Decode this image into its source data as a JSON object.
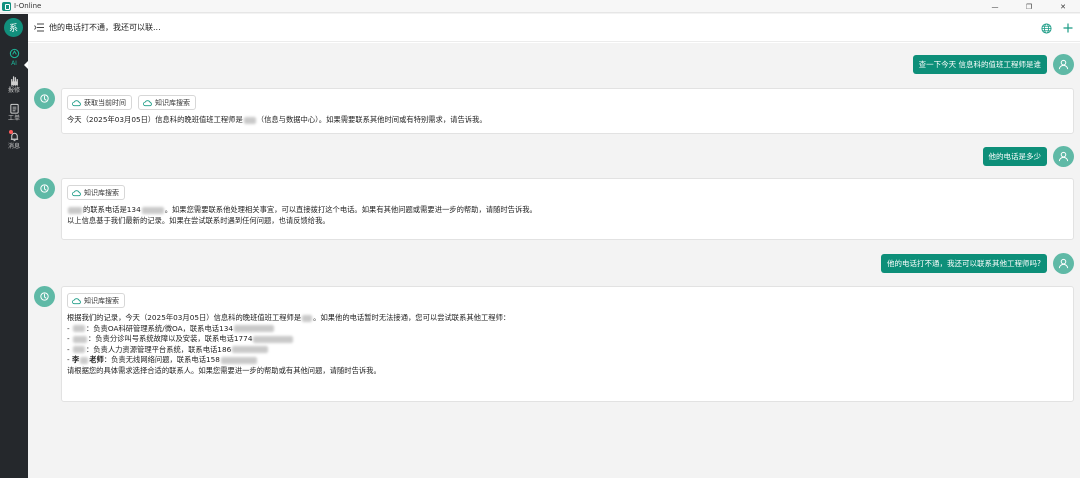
{
  "app": {
    "title": "I-Online"
  },
  "window": {
    "minimize": "—",
    "restore": "❐",
    "close": "✕"
  },
  "rail": {
    "avatar": "系",
    "items": [
      {
        "label": "AI",
        "icon": "ai-icon"
      },
      {
        "label": "报修",
        "icon": "hand-icon"
      },
      {
        "label": "工单",
        "icon": "clipboard-icon"
      },
      {
        "label": "消息",
        "icon": "bell-icon"
      }
    ]
  },
  "header": {
    "title": "他的电话打不通，我还可以联..."
  },
  "colors": {
    "accent": "#0d8f79",
    "rail": "#25282c"
  },
  "messages": {
    "u1": "查一下今天 信息科的值班工程师是谁",
    "b1": {
      "tools": [
        "获取当前时间",
        "知识库搜索"
      ],
      "l1a": "今天（2025年03月05日）信息科的晚班值班工程师是",
      "l1b": "（信息与数据中心）。如果需要联系其他时间或有特别需求，请告诉我。"
    },
    "u2": "他的电话是多少",
    "b2": {
      "tools": [
        "知识库搜索"
      ],
      "l1a": "的联系电话是134",
      "l1b": "。如果您需要联系他处理相关事宜，可以直接拨打这个电话。如果有其他问题或需要进一步的帮助，请随时告诉我。",
      "l2": "以上信息基于我们最新的记录。如果在尝试联系时遇到任何问题，也请反馈给我。"
    },
    "u3": "他的电话打不通，我还可以联系其他工程师吗?",
    "b3": {
      "tools": [
        "知识库搜索"
      ],
      "l1a": "根据我们的记录，今天（2025年03月05日）信息科的晚班值班工程师是",
      "l1b": "。如果他的电话暂时无法接通，您可以尝试联系其他工程师：",
      "dash": "- ",
      "i1a": "：负责OA科研管理系统/微OA，联系电话134",
      "i2a": "：负责分诊叫号系统故障以及安装，联系电话1774",
      "i3a": "：负责人力资源管理平台系统，联系电话186",
      "i4name": "李",
      "i4title": "老师",
      "i4a": "：负责无线网络问题，联系电话158",
      "l_end": "请根据您的具体需求选择合适的联系人。如果您需要进一步的帮助或有其他问题，请随时告诉我。"
    }
  }
}
